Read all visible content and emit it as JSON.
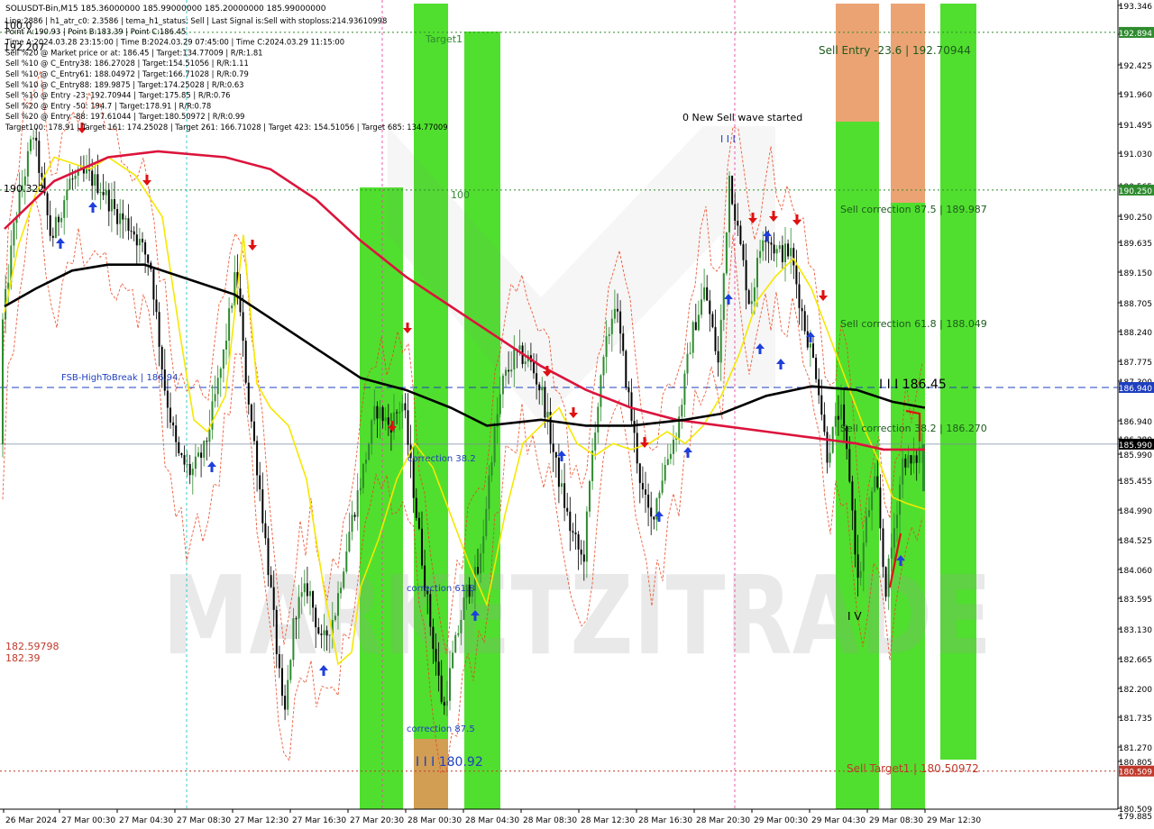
{
  "header": {
    "symbol_line": "SOLUSDT-Bin,M15  185.36000000 185.99000000 185.20000000 185.99000000",
    "info_lines": [
      "Line:2886 | h1_atr_c0: 2.3586 | tema_h1_status: Sell | Last Signal is:Sell with stoploss:214.93610998",
      "Point A:190.93 | Point B:183.39 | Point C:186.45",
      "Time A:2024.03.28 23:15:00 | Time B:2024.03.29 07:45:00 | Time C:2024.03.29 11:15:00",
      "Sell %20 @ Market price or at: 186.45 | Target:134.77009 | R/R:1.81",
      "Sell %10 @ C_Entry38: 186.27028 | Target:154.51056 | R/R:1.11",
      "Sell %10 @ C_Entry61: 188.04972 | Target:166.71028 | R/R:0.79",
      "Sell %10 @ C_Entry88: 189.9875 | Target:174.25028 | R/R:0.63",
      "Sell %10 @ Entry -23: 192.70944 | Target:175.85 | R/R:0.76",
      "Sell %20 @ Entry -50: 194.7 | Target:178.91 | R/R:0.78",
      "Sell %20 @ Entry -88: 197.61044 | Target:180.50972 | R/R:0.99",
      "Target100: 178.91 | Target 161: 174.25028 | Target 261: 166.71028 | Target 423: 154.51056 | Target 685: 134.77009"
    ]
  },
  "chart_data": {
    "type": "candlestick",
    "symbol": "SOLUSDT-Bin",
    "timeframe": "M15",
    "ohlc_current": {
      "open": 185.36,
      "high": 185.99,
      "low": 185.2,
      "close": 185.99
    },
    "ylim": [
      179.7,
      193.4
    ],
    "y_ticks": [
      "193.346",
      "192.894",
      "192.425",
      "191.960",
      "191.495",
      "191.030",
      "190.565",
      "190.250",
      "189.635",
      "189.150",
      "188.705",
      "188.240",
      "187.775",
      "187.300",
      "186.940",
      "186.380",
      "185.990",
      "185.455",
      "184.990",
      "184.525",
      "184.060",
      "183.595",
      "183.130",
      "182.665",
      "182.200",
      "181.735",
      "181.270",
      "180.805",
      "180.509",
      "179.885"
    ],
    "x_ticks": [
      "26 Mar 2024",
      "27 Mar 00:30",
      "27 Mar 04:30",
      "27 Mar 08:30",
      "27 Mar 12:30",
      "27 Mar 16:30",
      "27 Mar 20:30",
      "28 Mar 00:30",
      "28 Mar 04:30",
      "28 Mar 08:30",
      "28 Mar 12:30",
      "28 Mar 16:30",
      "28 Mar 20:30",
      "29 Mar 00:30",
      "29 Mar 04:30",
      "29 Mar 08:30",
      "29 Mar 12:30"
    ],
    "price_tags": [
      {
        "label": "192.894",
        "value": 192.894,
        "color": "#2e8b2e"
      },
      {
        "label": "190.250",
        "value": 190.25,
        "color": "#2e8b2e"
      },
      {
        "label": "186.940",
        "value": 186.94,
        "color": "#1f3fbf"
      },
      {
        "label": "185.990",
        "value": 185.99,
        "color": "#000000"
      },
      {
        "label": "180.509",
        "value": 180.509,
        "color": "#c0392b"
      }
    ],
    "levels": [
      {
        "name": "sell-entry-level",
        "value": 192.894,
        "color": "#2e8b2e",
        "style": "dotted"
      },
      {
        "name": "sell-correction-level",
        "value": 190.25,
        "color": "#2e8b2e",
        "style": "dotted"
      },
      {
        "name": "fsb-high-to-break",
        "value": 186.94,
        "color": "#1f3fbf",
        "style": "dashed"
      },
      {
        "name": "current-price",
        "value": 185.99,
        "color": "#7a8aa0",
        "style": "solid"
      },
      {
        "name": "sell-target1-level",
        "value": 180.509,
        "color": "#c0392b",
        "style": "dotted"
      }
    ],
    "annotations": [
      {
        "text": "Sell Entry -23.6 | 192.70944",
        "color": "#1e5a1e"
      },
      {
        "text": "Sell correction 87.5 | 189.987",
        "color": "#1e5a1e"
      },
      {
        "text": "Sell correction 61.8 | 188.049",
        "color": "#1e5a1e"
      },
      {
        "text": "Sell correction 38.2 | 186.270",
        "color": "#1e5a1e"
      },
      {
        "text": "Sell Target1 | 180.50972",
        "color": "#c0392b"
      },
      {
        "text": "0 New Sell wave started",
        "color": "#000000"
      },
      {
        "text": "FSB-HighToBreak | 186.94",
        "color": "#1f3fbf"
      },
      {
        "text": "correction 38.2",
        "color": "#1f3fbf"
      },
      {
        "text": "correction 61.8",
        "color": "#1f3fbf"
      },
      {
        "text": "correction 87.5",
        "color": "#1f3fbf"
      },
      {
        "text": "I I I 180.92",
        "color": "#1f3fbf"
      },
      {
        "text": "I I I 186.45",
        "color": "#000000"
      },
      {
        "text": "Target1",
        "color": "#2e8b2e"
      },
      {
        "text": "100",
        "color": "#2e8b2e"
      },
      {
        "text": "182.59798",
        "color": "#c0392b"
      },
      {
        "text": "182.39",
        "color": "#c0392b"
      },
      {
        "text": "I I I",
        "color": "#1f3fbf"
      },
      {
        "text": "I V",
        "color": "#000000"
      },
      {
        "text": "190.322",
        "color": "#000000"
      },
      {
        "text": "192.207",
        "color": "#000000"
      },
      {
        "text": "100.0",
        "color": "#000000"
      }
    ],
    "watermark": "MARKETZITRADE",
    "colors": {
      "bull": "#2e8b2e",
      "bear": "#000000",
      "zone_green": "#3ddc17",
      "zone_orange": "#e8935a",
      "ma_red": "#dc143c",
      "ma_black": "#000000",
      "yellow": "#f5e800",
      "envelope": "#e8431c",
      "arrow_up": "#1f3fdc",
      "arrow_down": "#e01010"
    }
  }
}
